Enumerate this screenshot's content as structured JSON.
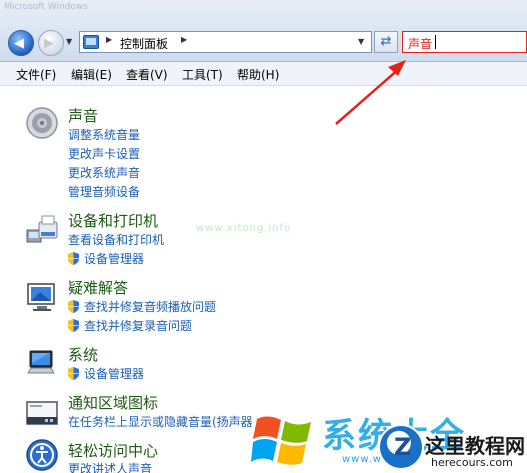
{
  "window": {
    "title": "Microsoft Windows"
  },
  "nav": {
    "address": {
      "label": "控制面板"
    },
    "search": {
      "value": "声音"
    }
  },
  "menu": {
    "items": [
      {
        "label": "文件(F)"
      },
      {
        "label": "编辑(E)"
      },
      {
        "label": "查看(V)"
      },
      {
        "label": "工具(T)"
      },
      {
        "label": "帮助(H)"
      }
    ]
  },
  "results": [
    {
      "title": "声音",
      "icon": "speaker-icon",
      "links": [
        "调整系统音量",
        "更改声卡设置",
        "更改系统声音",
        "管理音频设备"
      ]
    },
    {
      "title": "设备和打印机",
      "icon": "printer-icon",
      "links": [
        "查看设备和打印机"
      ],
      "shield_links": [
        "设备管理器"
      ]
    },
    {
      "title": "疑难解答",
      "icon": "troubleshoot-icon",
      "shield_links": [
        "查找并修复音频播放问题",
        "查找并修复录音问题"
      ]
    },
    {
      "title": "系统",
      "icon": "computer-icon",
      "shield_links": [
        "设备管理器"
      ]
    },
    {
      "title": "通知区域图标",
      "icon": "notification-area-icon",
      "links": [
        "在任务栏上显示或隐藏音量(扬声器"
      ]
    },
    {
      "title": "轻松访问中心",
      "icon": "ease-of-access-icon",
      "links": [
        "更改讲述人声音"
      ]
    }
  ],
  "watermarks": {
    "faint_text": "www.xitong.info",
    "logo1_text": "系统大全",
    "logo1_url": "www.win7pe",
    "badge_glyph": "Z",
    "brand_title": "这里教程网",
    "brand_url": "herecours.com"
  },
  "colors": {
    "accent_red": "#e2231a",
    "section_title_green": "#1e5a16",
    "link_blue": "#1b5fb5",
    "nav_bar_blue": "#cfdcee"
  }
}
